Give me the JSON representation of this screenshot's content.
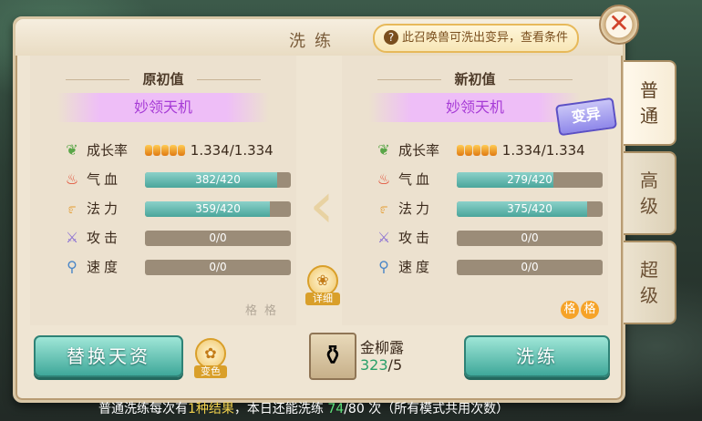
{
  "title": "洗练",
  "hint": {
    "icon": "question-icon",
    "text": "此召唤兽可洗出变异，查看条件"
  },
  "close_label": "✕",
  "left": {
    "header": "原初值",
    "name": "妙领天机",
    "growth": "1.334/1.334",
    "stats": [
      {
        "label": "气血",
        "value": "382/420",
        "ratio": 0.909,
        "icon": "blood-drop-icon"
      },
      {
        "label": "法力",
        "value": "359/420",
        "ratio": 0.855,
        "icon": "mana-swirl-icon"
      },
      {
        "label": "攻击",
        "value": "0/0",
        "ratio": 0,
        "icon": "sword-icon"
      },
      {
        "label": "速度",
        "value": "0/0",
        "ratio": 0,
        "icon": "boot-icon"
      }
    ],
    "ge": [
      "格",
      "格"
    ]
  },
  "right": {
    "header": "新初值",
    "name": "妙领天机",
    "mutation_badge": "变异",
    "growth": "1.334/1.334",
    "stats": [
      {
        "label": "气血",
        "value": "279/420",
        "ratio": 0.664,
        "icon": "blood-drop-icon"
      },
      {
        "label": "法力",
        "value": "375/420",
        "ratio": 0.893,
        "icon": "mana-swirl-icon"
      },
      {
        "label": "攻击",
        "value": "0/0",
        "ratio": 0,
        "icon": "sword-icon"
      },
      {
        "label": "速度",
        "value": "0/0",
        "ratio": 0,
        "icon": "boot-icon"
      }
    ],
    "ge": [
      "格",
      "格"
    ]
  },
  "growth_label": "成长率",
  "detail_label": "详细",
  "tint_label": "变色",
  "buttons": {
    "replace": "替换天资",
    "wash": "洗练"
  },
  "item": {
    "name": "金柳露",
    "count_current": "323",
    "count_total": "/5",
    "icon": "potion-vase-icon"
  },
  "tabs": [
    {
      "label": "普通",
      "active": true
    },
    {
      "label": "高级",
      "active": false
    },
    {
      "label": "超级",
      "active": false
    }
  ],
  "footer": {
    "p1": "普通洗练每次有",
    "p2": "1种结果",
    "p3": "，本日还能洗练 ",
    "p4": "74",
    "p5": "/80 次（所有模式共用次数）"
  }
}
